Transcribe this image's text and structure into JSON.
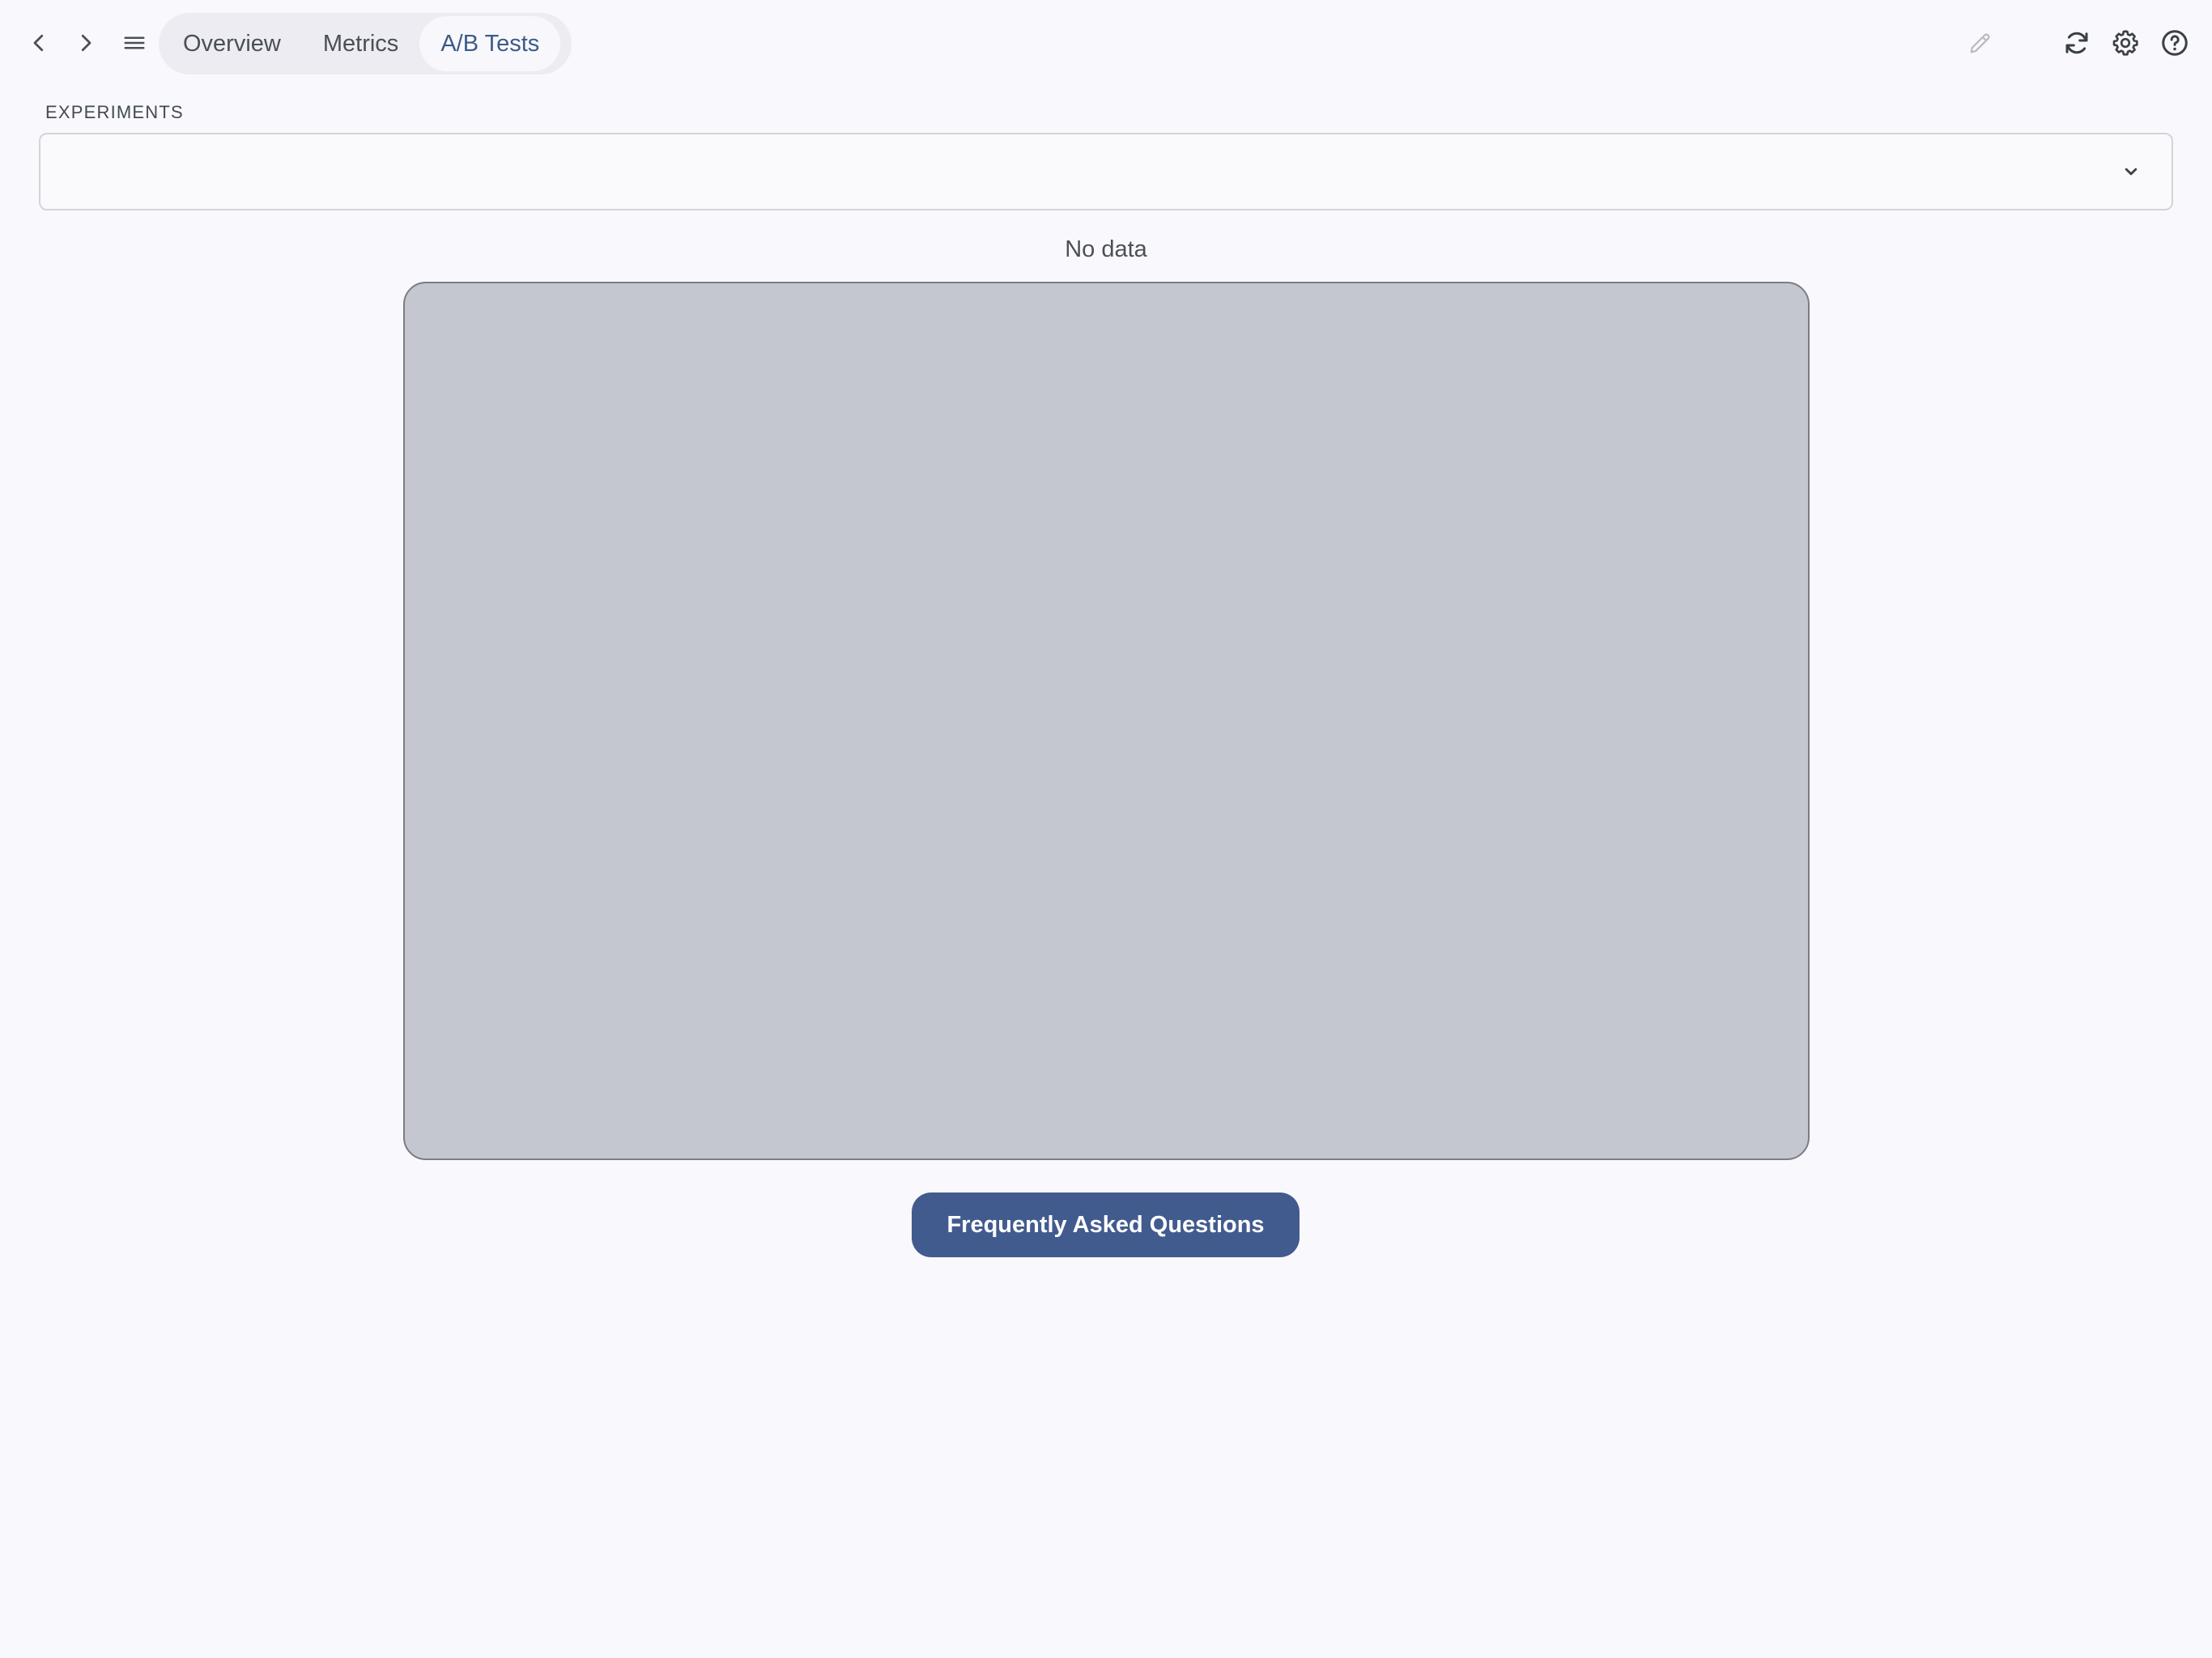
{
  "nav": {
    "back_icon": "chevron-left-icon",
    "forward_icon": "chevron-right-icon",
    "menu_icon": "hamburger-menu-icon"
  },
  "tabs": [
    {
      "label": "Overview",
      "active": false
    },
    {
      "label": "Metrics",
      "active": false
    },
    {
      "label": "A/B Tests",
      "active": true
    }
  ],
  "toolbar": {
    "edit_icon": "pencil-icon",
    "refresh_icon": "refresh-icon",
    "settings_icon": "gear-icon",
    "help_icon": "help-circle-icon"
  },
  "experiments": {
    "label": "EXPERIMENTS",
    "selected": "",
    "dropdown_icon": "chevron-down-icon"
  },
  "main": {
    "empty_message": "No data"
  },
  "faq": {
    "label": "Frequently Asked Questions"
  },
  "colors": {
    "background": "#f9f9fd",
    "accent": "#425b8f",
    "active_tab_text": "#3d5a88",
    "placeholder": "#c4c7cf"
  }
}
